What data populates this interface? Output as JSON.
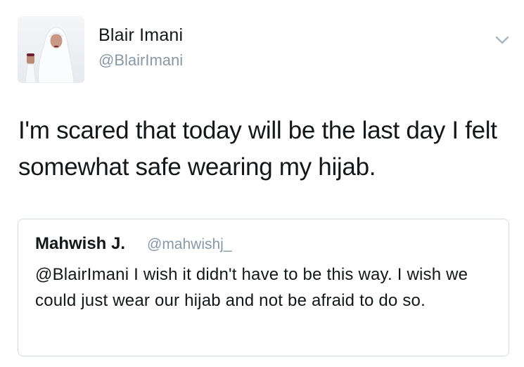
{
  "tweet": {
    "author": {
      "name": "Blair Imani",
      "handle": "@BlairImani"
    },
    "text": "I'm scared that today will be the last day I felt somewhat safe wearing my hijab.",
    "menu_icon": "chevron-down-icon"
  },
  "quoted_tweet": {
    "author": {
      "name": "Mahwish J.",
      "handle": "@mahwishj_"
    },
    "text": "@BlairImani I wish it didn't have to be this way. I wish we could just wear our hijab and not be afraid to do so."
  },
  "colors": {
    "text_primary": "#14171a",
    "text_secondary": "#8899a6",
    "border": "#d4dbe0",
    "background": "#ffffff"
  }
}
